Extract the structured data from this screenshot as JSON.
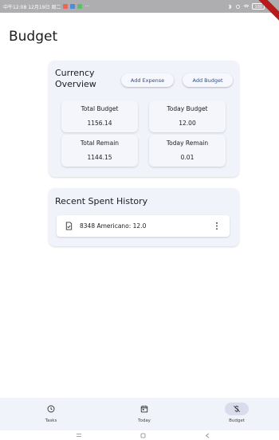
{
  "status_bar": {
    "left_text": "中午12:08 12月19日 周二",
    "extra": "···",
    "battery": "100"
  },
  "page": {
    "title": "Budget"
  },
  "overview": {
    "title": "Currency Overview",
    "add_expense_label": "Add Expense",
    "add_budget_label": "Add Budget",
    "stats": [
      {
        "label": "Total Budget",
        "value": "1156.14"
      },
      {
        "label": "Today Budget",
        "value": "12.00"
      },
      {
        "label": "Total Remain",
        "value": "1144.15"
      },
      {
        "label": "Today Remain",
        "value": "0.01"
      }
    ]
  },
  "history": {
    "title": "Recent Spent History",
    "items": [
      {
        "text": "8348 Americano: 12.0",
        "icon": "receipt-icon"
      }
    ]
  },
  "bottom_nav": {
    "items": [
      {
        "label": "Tasks",
        "icon": "clock-icon",
        "active": false
      },
      {
        "label": "Today",
        "icon": "calendar-icon",
        "active": false
      },
      {
        "label": "Budget",
        "icon": "money-off-icon",
        "active": true
      }
    ]
  },
  "colors": {
    "accent": "#2a4d86",
    "card_bg": "#f1f3fb",
    "nav_bg": "#f1f3fa",
    "active_indicator": "#d9dcea"
  }
}
